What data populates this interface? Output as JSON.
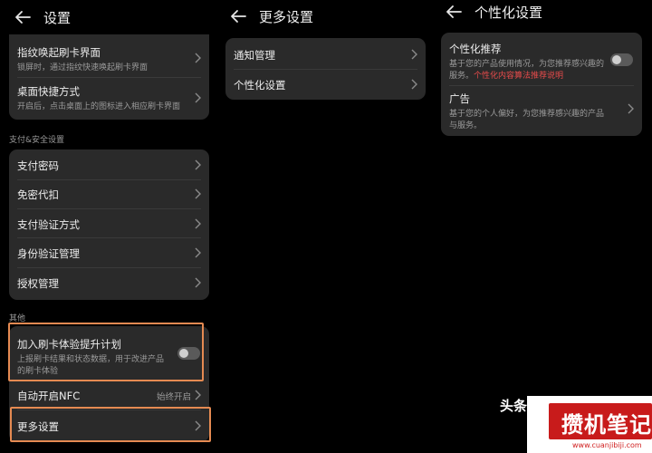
{
  "panel1": {
    "title": "设置",
    "group1": [
      {
        "title": "指纹唤起刷卡界面",
        "sub": "锁屏时，通过指纹快速唤起刷卡界面"
      },
      {
        "title": "桌面快捷方式",
        "sub": "开启后，点击桌面上的图标进入相应刷卡界面"
      }
    ],
    "section_payment": "支付&安全设置",
    "group2": [
      "支付密码",
      "免密代扣",
      "支付验证方式",
      "身份验证管理",
      "授权管理"
    ],
    "section_other": "其他",
    "group3": {
      "join": {
        "title": "加入刷卡体验提升计划",
        "sub": "上报刷卡结果和状态数据，用于改进产品的刷卡体验",
        "toggle_on": false
      },
      "nfc": {
        "title": "自动开启NFC",
        "value": "始终开启"
      },
      "more": {
        "title": "更多设置"
      }
    }
  },
  "panel2": {
    "title": "更多设置",
    "items": [
      "通知管理",
      "个性化设置"
    ]
  },
  "panel3": {
    "title": "个性化设置",
    "recommend": {
      "title": "个性化推荐",
      "sub_prefix": "基于您的产品使用情况，为您推荐感兴趣的服务。",
      "sub_link": "个性化内容算法推荐说明",
      "toggle_on": false
    },
    "ads": {
      "title": "广告",
      "sub": "基于您的个人偏好，为您推荐感兴趣的产品与服务。"
    }
  },
  "watermark": {
    "prefix": "头条",
    "logo": "攒机笔记",
    "url": "www.cuanjibiji.com"
  },
  "colors": {
    "background": "#000000",
    "card": "#2a2a2a",
    "highlight": "#e58a52",
    "link": "#e64b4b",
    "brand": "#c81b1b"
  }
}
